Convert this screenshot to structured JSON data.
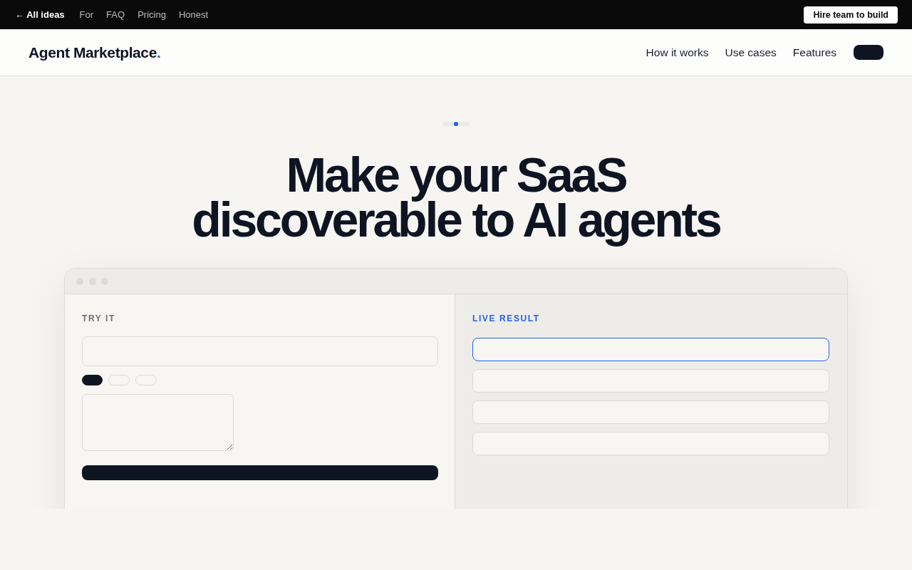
{
  "top_bar": {
    "back_link": "← All ideas",
    "links": [
      "For",
      "FAQ",
      "Pricing",
      "Honest"
    ],
    "cta": "Hire team to build"
  },
  "header": {
    "logo": {
      "text": "Agent Marketplace",
      "accent": "."
    },
    "nav": [
      "How it works",
      "Use cases",
      "Features"
    ]
  },
  "hero": {
    "title": "Make your SaaS discoverable to AI agents"
  },
  "demo": {
    "try_it": {
      "label": "TRY IT",
      "chips": [
        {
          "selected": true
        },
        {
          "selected": false
        },
        {
          "selected": false
        }
      ]
    },
    "live_result": {
      "label": "LIVE RESULT",
      "results": [
        {
          "selected": true
        },
        {
          "selected": false
        },
        {
          "selected": false
        },
        {
          "selected": false
        }
      ]
    }
  }
}
